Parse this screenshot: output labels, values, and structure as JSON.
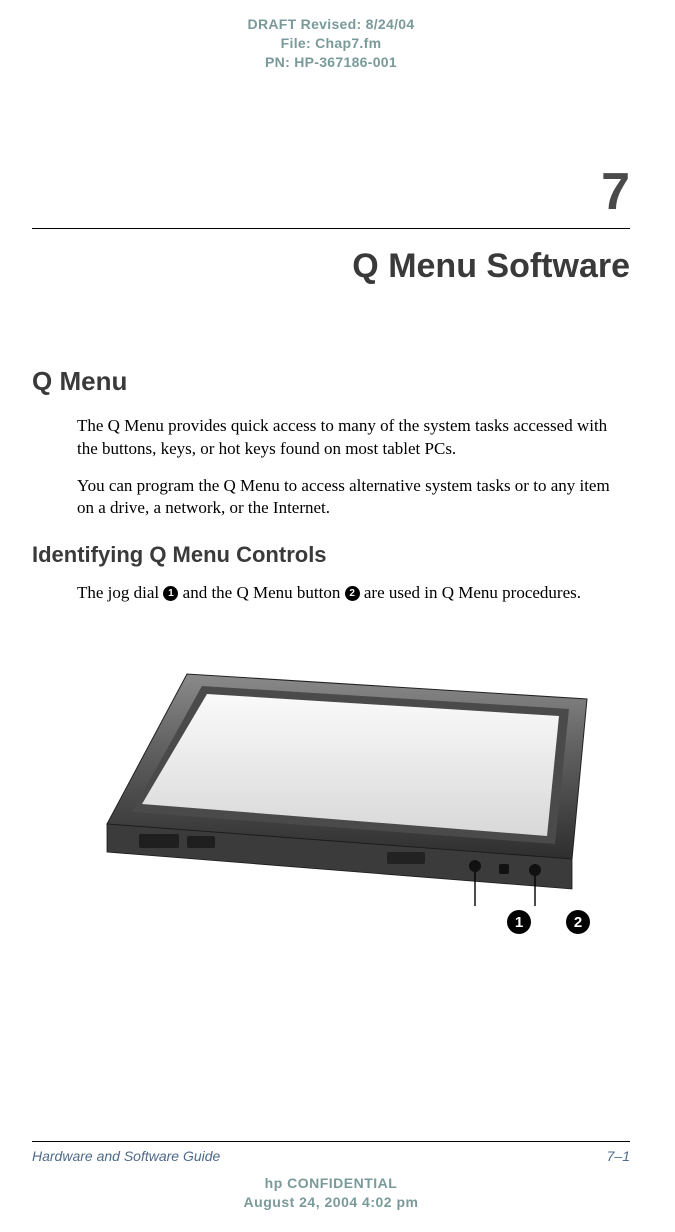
{
  "header": {
    "draft": "DRAFT Revised: 8/24/04",
    "file": "File: Chap7.fm",
    "pn": "PN: HP-367186-001"
  },
  "chapter": {
    "number": "7",
    "title": "Q Menu Software"
  },
  "section1": {
    "heading": "Q Menu",
    "p1": "The Q Menu provides quick access to many of the system tasks accessed with the buttons, keys, or hot keys found on most tablet PCs.",
    "p2": "You can program the Q Menu to access alternative system tasks or to any item on a drive, a network, or the Internet."
  },
  "section2": {
    "heading": "Identifying Q Menu Controls",
    "p1_a": "The jog dial ",
    "p1_b": " and the Q Menu button ",
    "p1_c": " are used in Q Menu procedures.",
    "c1": "1",
    "c2": "2"
  },
  "callouts": {
    "c1": "1",
    "c2": "2"
  },
  "footer": {
    "guide": "Hardware and Software Guide",
    "page": "7–1",
    "conf": "hp CONFIDENTIAL",
    "date": "August 24, 2004 4:02 pm"
  }
}
